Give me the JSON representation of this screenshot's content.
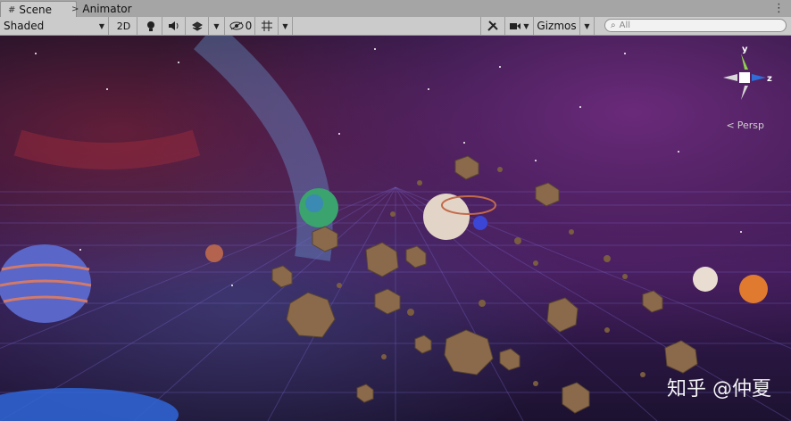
{
  "tabs": [
    {
      "label": "Scene",
      "icon": "hash-grid-icon",
      "active": true
    },
    {
      "label": "Animator",
      "icon": "animator-icon",
      "active": false
    }
  ],
  "toolbar": {
    "shading_mode": "Shaded",
    "mode_2d": "2D",
    "hidden_count": "0",
    "gizmos_label": "Gizmos",
    "search_placeholder": "All"
  },
  "gizmo": {
    "y": "y",
    "z": "z",
    "projection": "Persp"
  },
  "watermark": "知乎 @仲夏",
  "colors": {
    "tabbar_bg": "#a5a5a5",
    "toolbar_bg": "#cbcbcb",
    "gizmo_x": "#c23b32",
    "gizmo_y": "#8fd14f",
    "gizmo_z": "#2f6ed8"
  }
}
